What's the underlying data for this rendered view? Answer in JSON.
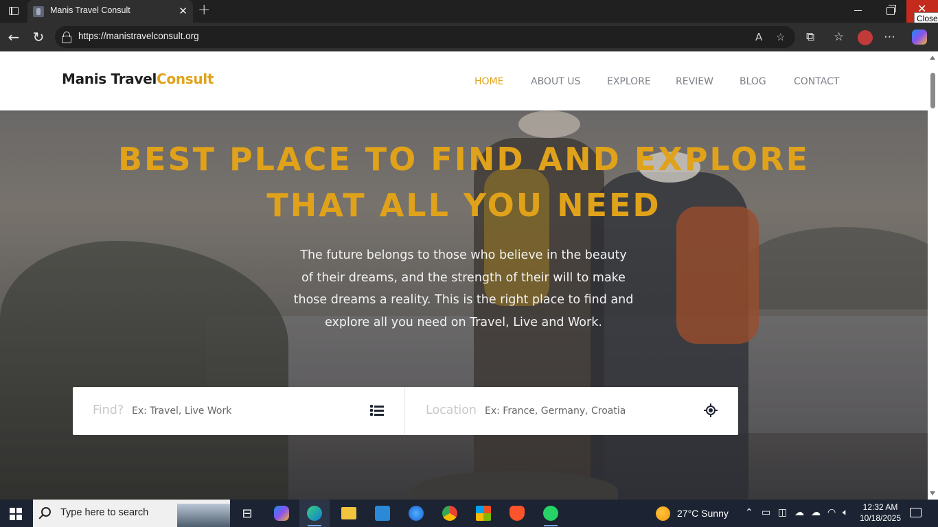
{
  "browser": {
    "tab_title": "Manis Travel Consult",
    "new_tab_symbol": "+",
    "tab_close_symbol": "✕",
    "url": "https://manistravelconsult.org",
    "close_tooltip": "Close",
    "close_symbol": "✕"
  },
  "site": {
    "logo_main": "Manis Travel",
    "logo_accent": "Consult",
    "accent_color": "#e0a21a",
    "nav": [
      {
        "label": "HOME",
        "active": true
      },
      {
        "label": "ABOUT US",
        "active": false
      },
      {
        "label": "EXPLORE",
        "active": false
      },
      {
        "label": "REVIEW",
        "active": false
      },
      {
        "label": "BLOG",
        "active": false
      },
      {
        "label": "CONTACT",
        "active": false
      }
    ],
    "hero": {
      "title_line1": "BEST PLACE TO FIND AND EXPLORE",
      "title_line2": "THAT ALL YOU NEED",
      "subtitle_lines": [
        "The future belongs to those who believe in the beauty",
        "of their dreams, and the strength of their will to make",
        "those dreams a reality. This is the right place to find and",
        "explore all you need on Travel, Live and Work."
      ]
    },
    "search": {
      "find_label": "Find?",
      "find_placeholder": "Ex: Travel, Live Work",
      "location_label": "Location",
      "location_placeholder": "Ex: France, Germany, Croatia"
    }
  },
  "taskbar": {
    "search_placeholder": "Type here to search",
    "weather": "27°C  Sunny",
    "time": "12:32 AM",
    "date": "10/18/2025"
  }
}
